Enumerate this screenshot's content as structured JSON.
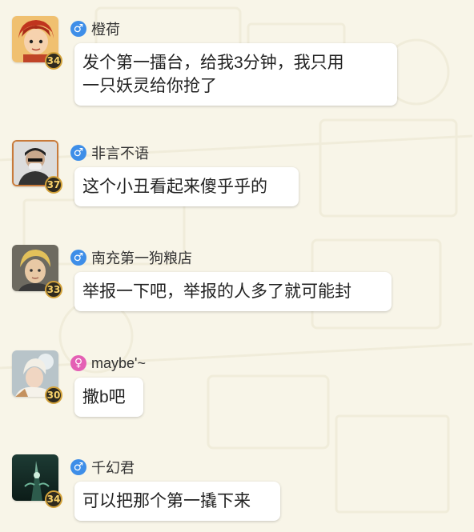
{
  "messages": [
    {
      "username": "橙荷",
      "gender": "male",
      "gender_symbol": "♂",
      "level": "34",
      "text_lines": [
        "发个第一擂台，给我3分钟，我只用",
        "一只妖灵给你抢了"
      ]
    },
    {
      "username": "非言不语",
      "gender": "male",
      "gender_symbol": "♂",
      "level": "37",
      "text_lines": [
        "这个小丑看起来傻乎乎的"
      ]
    },
    {
      "username": "南充第一狗粮店",
      "gender": "male",
      "gender_symbol": "♂",
      "level": "33",
      "text_lines": [
        "举报一下吧，举报的人多了就可能封"
      ]
    },
    {
      "username": "maybe'~",
      "gender": "female",
      "gender_symbol": "♀",
      "level": "30",
      "text_lines": [
        "撒b吧"
      ]
    },
    {
      "username": "千幻君",
      "gender": "male",
      "gender_symbol": "♂",
      "level": "34",
      "text_lines": [
        "可以把那个第一撬下来"
      ]
    }
  ],
  "colors": {
    "male": "#3e8ee8",
    "female": "#e45fb4",
    "background": "#f8f5e8"
  }
}
